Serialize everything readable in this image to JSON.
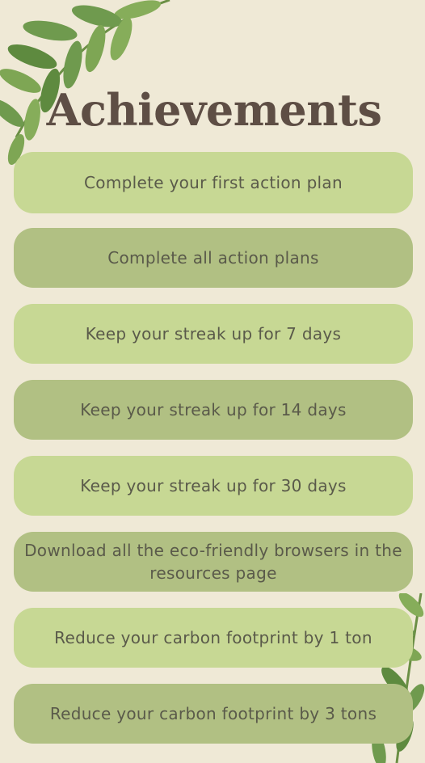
{
  "page": {
    "title": "Achievements",
    "colors": {
      "background": "#efe9d6",
      "title": "#5e4e45",
      "card_light": "#c7d894",
      "card_dark": "#b1c083",
      "card_text": "#5a5a4a",
      "leaf": "#6f9a4e"
    }
  },
  "achievements": [
    {
      "label": "Complete your first action plan"
    },
    {
      "label": "Complete all action plans"
    },
    {
      "label": "Keep your streak up for 7 days"
    },
    {
      "label": "Keep your streak up for 14 days"
    },
    {
      "label": "Keep your streak up for 30 days"
    },
    {
      "label": "Download all the eco-friendly browsers in the resources page"
    },
    {
      "label": "Reduce your carbon footprint by 1 ton"
    },
    {
      "label": "Reduce your carbon footprint by 3 tons"
    }
  ],
  "decorations": {
    "top_left": "leaf-branch-icon",
    "bottom_right": "leaf-branch-icon"
  }
}
